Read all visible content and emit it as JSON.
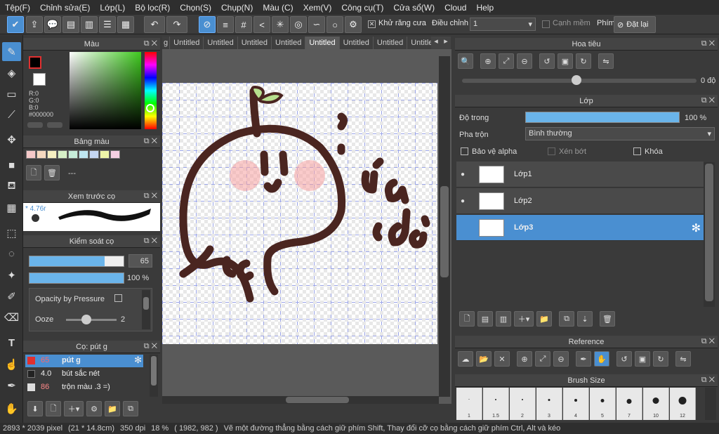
{
  "menu": [
    "Tệp(F)",
    "Chỉnh sửa(E)",
    "Lớp(L)",
    "Bộ lọc(R)",
    "Chọn(S)",
    "Chụp(N)",
    "Màu (C)",
    "Xem(V)",
    "Công cụ(T)",
    "Cửa sổ(W)",
    "Cloud",
    "Help"
  ],
  "toolbar": {
    "antialias": "Khử răng cưa",
    "correction_label": "Điều chỉnh",
    "correction_value": "1",
    "smooth_edge": "Cạnh mềm",
    "key_label": "Phím",
    "reset": "Đặt lại"
  },
  "color_panel": {
    "title": "Màu",
    "r": "R:0",
    "g": "G:0",
    "b": "B:0",
    "hex": "#000000",
    "fg": "#000000"
  },
  "palette": {
    "title": "Bảng màu",
    "swatches": [
      "#f5c9c9",
      "#f6d9c0",
      "#f6efc2",
      "#d7f0c8",
      "#c7ecd9",
      "#bfe6ef",
      "#c5d6f2",
      "#eef5a8",
      "#f5d0e2"
    ],
    "empty": "---"
  },
  "brush_preview": {
    "title": "Xem trước cọ",
    "size": "* 4.76r"
  },
  "brush_control": {
    "title": "Kiểm soát cọ",
    "size": "65",
    "opacity": "100 %",
    "pressure": "Opacity by Pressure",
    "ooze": "Ooze",
    "ooze_value": "2",
    "size_level": 0.8,
    "opacity_level": 1.0
  },
  "brush_list": {
    "title": "Cọ: pút g",
    "items": [
      {
        "size": "65",
        "name": "pút g",
        "color": "#e03030"
      },
      {
        "size": "4.0",
        "name": "bút sắc nét",
        "color": "#222222"
      },
      {
        "size": "86",
        "name": "trộn màu .3 =)",
        "color": "#dddddd"
      }
    ]
  },
  "tabs": [
    "Untitled",
    "Untitled",
    "Untitled",
    "Untitled",
    "Untitled",
    "Untitled",
    "Untitled",
    "Untitled"
  ],
  "navigator": {
    "title": "Hoa tiêu",
    "rotation": "0 độ"
  },
  "layer_panel": {
    "title": "Lớp",
    "opacity_label": "Độ trong",
    "opacity_value": "100 %",
    "blend_label": "Pha trộn",
    "blend_value": "Bình thường",
    "protect_alpha": "Bảo vệ alpha",
    "clipping": "Xén bớt",
    "lock": "Khóa",
    "layers": [
      "Lớp1",
      "Lớp2",
      "Lớp3"
    ]
  },
  "reference": {
    "title": "Reference"
  },
  "brush_size": {
    "title": "Brush Size",
    "sizes": [
      "1",
      "1.5",
      "2",
      "3",
      "4",
      "5",
      "7",
      "10",
      "12"
    ]
  },
  "status": {
    "dims": "2893 * 2039 pixel",
    "cm": "(21 * 14.8cm)",
    "dpi": "350 dpi",
    "zoom": "18 %",
    "coords": "( 1982, 982 )",
    "hint": "Vẽ một đường thẳng bằng cách giữ phím Shift, Thay đổi cỡ cọ bằng cách giữ phím Ctrl, Alt và kéo"
  }
}
